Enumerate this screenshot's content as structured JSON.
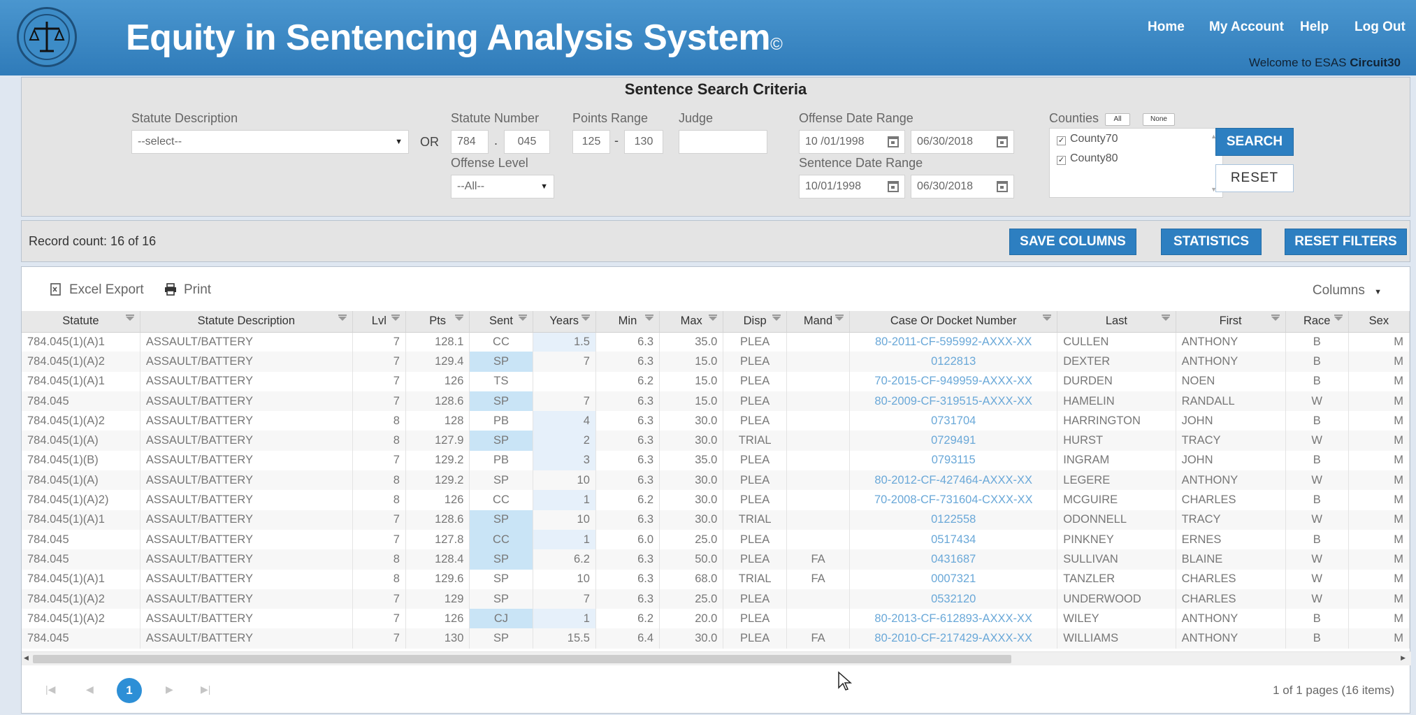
{
  "header": {
    "title": "Equity in Sentencing Analysis System",
    "title_mark": "©",
    "nav": [
      "Home",
      "My Account",
      "Help",
      "Log Out"
    ],
    "welcome_prefix": "Welcome to ESAS ",
    "welcome_user": "Circuit30"
  },
  "criteria": {
    "title": "Sentence Search Criteria",
    "statute_desc_label": "Statute Description",
    "statute_desc_value": "--select--",
    "or_label": "OR",
    "statute_number_label": "Statute Number",
    "statute_number_a": "784",
    "statute_number_dot": ".",
    "statute_number_b": "045",
    "points_range_label": "Points Range",
    "points_from": "125",
    "points_dash": "-",
    "points_to": "130",
    "judge_label": "Judge",
    "judge_value": "",
    "offense_level_label": "Offense Level",
    "offense_level_value": "--All--",
    "offense_date_label": "Offense Date Range",
    "offense_from": "10 /01/1998",
    "offense_to": "06/30/2018",
    "sentence_date_label": "Sentence Date Range",
    "sentence_from": "10/01/1998",
    "sentence_to": "06/30/2018",
    "counties_label": "Counties",
    "counties_all": "All",
    "counties_none": "None",
    "counties": [
      "County70",
      "County80"
    ],
    "search_button": "SEARCH",
    "reset_button": "RESET"
  },
  "record_bar": {
    "record_count": "Record count: 16 of 16",
    "save_columns": "SAVE COLUMNS",
    "statistics": "STATISTICS",
    "reset_filters": "RESET FILTERS"
  },
  "grid": {
    "excel_export": "Excel Export",
    "print": "Print",
    "columns_button": "Columns",
    "headers": [
      "Statute",
      "Statute Description",
      "Lvl",
      "Pts",
      "Sent",
      "Years",
      "Min",
      "Max",
      "Disp",
      "Mand",
      "Case Or Docket Number",
      "Last",
      "First",
      "Race",
      "Sex"
    ],
    "rows": [
      [
        "784.045(1)(A)1",
        "ASSAULT/BATTERY",
        "7",
        "128.1",
        "CC",
        "1.5",
        "6.3",
        "35.0",
        "PLEA",
        "",
        "80-2011-CF-595992-AXXX-XX",
        "CULLEN",
        "ANTHONY",
        "B",
        "M"
      ],
      [
        "784.045(1)(A)2",
        "ASSAULT/BATTERY",
        "7",
        "129.4",
        "SP",
        "7",
        "6.3",
        "15.0",
        "PLEA",
        "",
        "0122813",
        "DEXTER",
        "ANTHONY",
        "B",
        "M"
      ],
      [
        "784.045(1)(A)1",
        "ASSAULT/BATTERY",
        "7",
        "126",
        "TS",
        "",
        "6.2",
        "15.0",
        "PLEA",
        "",
        "70-2015-CF-949959-AXXX-XX",
        "DURDEN",
        "NOEN",
        "B",
        "M"
      ],
      [
        "784.045",
        "ASSAULT/BATTERY",
        "7",
        "128.6",
        "SP",
        "7",
        "6.3",
        "15.0",
        "PLEA",
        "",
        "80-2009-CF-319515-AXXX-XX",
        "HAMELIN",
        "RANDALL",
        "W",
        "M"
      ],
      [
        "784.045(1)(A)2",
        "ASSAULT/BATTERY",
        "8",
        "128",
        "PB",
        "4",
        "6.3",
        "30.0",
        "PLEA",
        "",
        "0731704",
        "HARRINGTON",
        "JOHN",
        "B",
        "M"
      ],
      [
        "784.045(1)(A)",
        "ASSAULT/BATTERY",
        "8",
        "127.9",
        "SP",
        "2",
        "6.3",
        "30.0",
        "TRIAL",
        "",
        "0729491",
        "HURST",
        "TRACY",
        "W",
        "M"
      ],
      [
        "784.045(1)(B)",
        "ASSAULT/BATTERY",
        "7",
        "129.2",
        "PB",
        "3",
        "6.3",
        "35.0",
        "PLEA",
        "",
        "0793115",
        "INGRAM",
        "JOHN",
        "B",
        "M"
      ],
      [
        "784.045(1)(A)",
        "ASSAULT/BATTERY",
        "8",
        "129.2",
        "SP",
        "10",
        "6.3",
        "30.0",
        "PLEA",
        "",
        "80-2012-CF-427464-AXXX-XX",
        "LEGERE",
        "ANTHONY",
        "W",
        "M"
      ],
      [
        "784.045(1)(A)2)",
        "ASSAULT/BATTERY",
        "8",
        "126",
        "CC",
        "1",
        "6.2",
        "30.0",
        "PLEA",
        "",
        "70-2008-CF-731604-CXXX-XX",
        "MCGUIRE",
        "CHARLES",
        "B",
        "M"
      ],
      [
        "784.045(1)(A)1",
        "ASSAULT/BATTERY",
        "7",
        "128.6",
        "SP",
        "10",
        "6.3",
        "30.0",
        "TRIAL",
        "",
        "0122558",
        "ODONNELL",
        "TRACY",
        "W",
        "M"
      ],
      [
        "784.045",
        "ASSAULT/BATTERY",
        "7",
        "127.8",
        "CC",
        "1",
        "6.0",
        "25.0",
        "PLEA",
        "",
        "0517434",
        "PINKNEY",
        "ERNES",
        "B",
        "M"
      ],
      [
        "784.045",
        "ASSAULT/BATTERY",
        "8",
        "128.4",
        "SP",
        "6.2",
        "6.3",
        "50.0",
        "PLEA",
        "FA",
        "0431687",
        "SULLIVAN",
        "BLAINE",
        "W",
        "M"
      ],
      [
        "784.045(1)(A)1",
        "ASSAULT/BATTERY",
        "8",
        "129.6",
        "SP",
        "10",
        "6.3",
        "68.0",
        "TRIAL",
        "FA",
        "0007321",
        "TANZLER",
        "CHARLES",
        "W",
        "M"
      ],
      [
        "784.045(1)(A)2",
        "ASSAULT/BATTERY",
        "7",
        "129",
        "SP",
        "7",
        "6.3",
        "25.0",
        "PLEA",
        "",
        "0532120",
        "UNDERWOOD",
        "CHARLES",
        "W",
        "M"
      ],
      [
        "784.045(1)(A)2",
        "ASSAULT/BATTERY",
        "7",
        "126",
        "CJ",
        "1",
        "6.2",
        "20.0",
        "PLEA",
        "",
        "80-2013-CF-612893-AXXX-XX",
        "WILEY",
        "ANTHONY",
        "B",
        "M"
      ],
      [
        "784.045",
        "ASSAULT/BATTERY",
        "7",
        "130",
        "SP",
        "15.5",
        "6.4",
        "30.0",
        "PLEA",
        "FA",
        "80-2010-CF-217429-AXXX-XX",
        "WILLIAMS",
        "ANTHONY",
        "B",
        "M"
      ]
    ],
    "highlight_sent_rows": [
      1,
      3,
      5,
      9,
      10,
      11,
      14
    ],
    "highlight_years_rows": [
      0,
      4,
      5,
      6,
      8,
      10,
      14
    ]
  },
  "pager": {
    "first_icon": "first-page-icon",
    "prev_icon": "prev-page-icon",
    "current_page": "1",
    "next_icon": "next-page-icon",
    "last_icon": "last-page-icon",
    "info": "1 of 1 pages (16 items)"
  },
  "colors": {
    "header_blue": "#2f7bb9",
    "button_blue": "#2d7fc1",
    "link_blue": "#6aa8d8",
    "highlight": "#c9e4f6"
  }
}
